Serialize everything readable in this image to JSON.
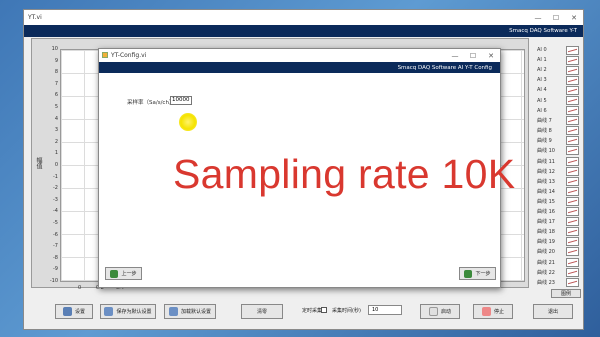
{
  "main_window": {
    "title": "YT.vi",
    "brand": "Smacq DAQ Software Y-T",
    "controls": {
      "minimize": "—",
      "maximize": "☐",
      "close": "✕"
    }
  },
  "plot": {
    "y_axis_label": "幅值",
    "y_ticks": [
      "10",
      "9",
      "8",
      "7",
      "6",
      "5",
      "4",
      "3",
      "2",
      "1",
      "0",
      "-1",
      "-2",
      "-3",
      "-4",
      "-5",
      "-6",
      "-7",
      "-8",
      "-9",
      "-10"
    ],
    "x_ticks": [
      "0",
      "0.2",
      "0.4"
    ]
  },
  "legend": {
    "items": [
      "AI 0",
      "AI 1",
      "AI 2",
      "AI 3",
      "AI 4",
      "AI 5",
      "AI 6",
      "曲线 7",
      "曲线 8",
      "曲线 9",
      "曲线 10",
      "曲线 11",
      "曲线 12",
      "曲线 13",
      "曲线 14",
      "曲线 15",
      "曲线 16",
      "曲线 17",
      "曲线 18",
      "曲线 19",
      "曲线 20",
      "曲线 21",
      "曲线 22",
      "曲线 23"
    ],
    "button": "图例"
  },
  "bottombar": {
    "settings": "设置",
    "save_default": "保存为默认设置",
    "load_default": "加载默认设置",
    "clear": "清零",
    "timed_capture": "定时采集",
    "capture_time_label": "采集时间(秒)",
    "capture_time_value": "10",
    "start": "启动",
    "stop": "停止",
    "exit": "退出"
  },
  "dialog": {
    "title": "YT-Config.vi",
    "brand": "Smacq DAQ Software AI Y-T Config",
    "sampling_rate_label": "采样率（Sa/s/ch）",
    "sampling_rate_value": "10000",
    "prev_button": "上一步",
    "next_button": "下一步",
    "controls": {
      "minimize": "—",
      "maximize": "☐",
      "close": "✕"
    }
  },
  "overlay_caption": "Sampling rate 10K",
  "colors": {
    "brand_bar": "#0b2a5a",
    "overlay_text": "#d9382f",
    "cursor_highlight": "#f5e300"
  }
}
